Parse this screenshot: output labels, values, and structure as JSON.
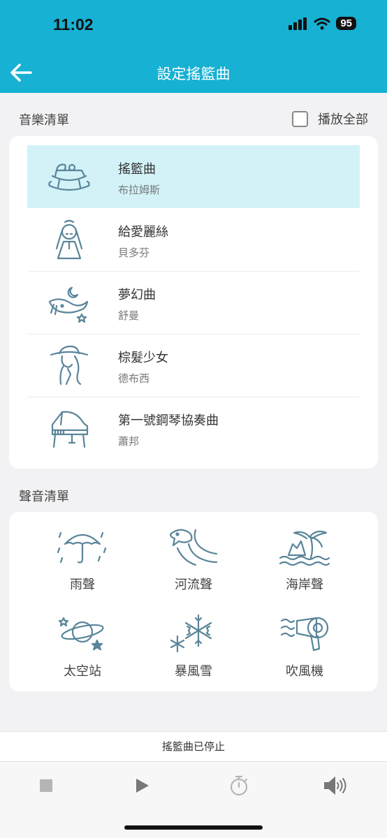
{
  "status": {
    "time": "11:02",
    "battery": "95"
  },
  "nav": {
    "title": "設定搖籃曲",
    "back_icon": "arrow-left-icon"
  },
  "music": {
    "section_label": "音樂清單",
    "play_all_label": "播放全部",
    "play_all_checked": false,
    "tracks": [
      {
        "title": "搖籃曲",
        "artist": "布拉姆斯",
        "icon": "cradle-icon",
        "selected": true
      },
      {
        "title": "給愛麗絲",
        "artist": "貝多芬",
        "icon": "girl-icon",
        "selected": false
      },
      {
        "title": "夢幻曲",
        "artist": "舒曼",
        "icon": "whale-moon-icon",
        "selected": false
      },
      {
        "title": "棕髮少女",
        "artist": "德布西",
        "icon": "girl-hat-icon",
        "selected": false
      },
      {
        "title": "第一號鋼琴協奏曲",
        "artist": "蕭邦",
        "icon": "piano-icon",
        "selected": false
      }
    ]
  },
  "sounds": {
    "section_label": "聲音清單",
    "items": [
      {
        "label": "雨聲",
        "icon": "umbrella-rain-icon"
      },
      {
        "label": "河流聲",
        "icon": "fish-river-icon"
      },
      {
        "label": "海岸聲",
        "icon": "palm-beach-icon"
      },
      {
        "label": "太空站",
        "icon": "planet-icon"
      },
      {
        "label": "暴風雪",
        "icon": "snowflake-icon"
      },
      {
        "label": "吹風機",
        "icon": "hair-dryer-icon"
      }
    ]
  },
  "player": {
    "status_text": "搖籃曲已停止",
    "controls": [
      "stop-icon",
      "play-icon",
      "timer-icon",
      "volume-icon"
    ]
  },
  "colors": {
    "header": "#16b1d3",
    "selected_row": "#d2f2f8",
    "icon_stroke": "#5a8599"
  }
}
